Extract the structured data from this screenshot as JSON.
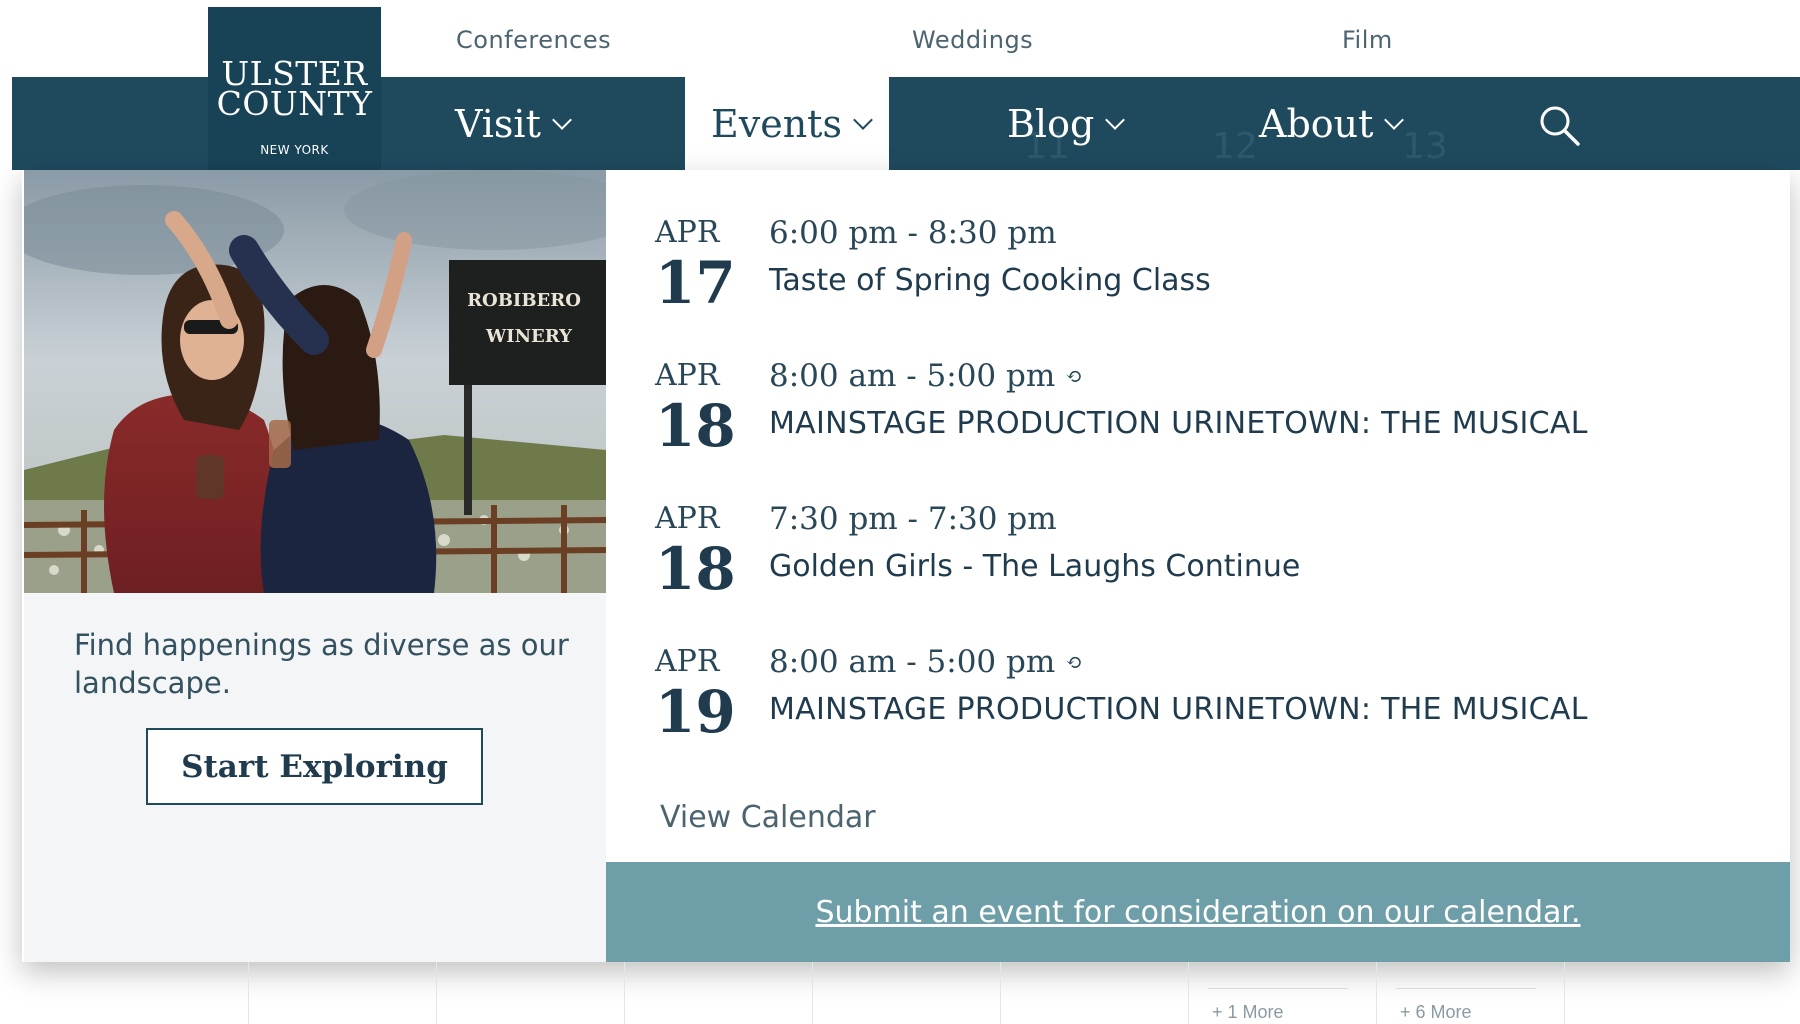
{
  "utility_nav": [
    "Conferences",
    "Weddings",
    "Film"
  ],
  "logo": {
    "line1": "ULSTER",
    "line2": "COUNTY",
    "line3": "NEW YORK"
  },
  "nav": {
    "items": [
      {
        "label": "Visit"
      },
      {
        "label": "Events"
      },
      {
        "label": "Blog"
      },
      {
        "label": "About"
      }
    ],
    "search_icon": "search-icon"
  },
  "background_calendar": {
    "dates": [
      "11",
      "12",
      "13"
    ],
    "more_links": [
      "+ 1 More",
      "+ 6 More"
    ]
  },
  "promo": {
    "image": "photo of two women celebrating outside Robibero Winery sign",
    "sign_text": [
      "ROBIBERO",
      "WINERY"
    ],
    "tagline": "Find happenings as diverse as our landscape.",
    "button_label": "Start Exploring"
  },
  "events": [
    {
      "month": "APR",
      "day": "17",
      "time": "6:00 pm - 8:30 pm",
      "recurring": false,
      "title": "Taste of Spring Cooking Class"
    },
    {
      "month": "APR",
      "day": "18",
      "time": "8:00 am - 5:00 pm",
      "recurring": true,
      "title": "MAINSTAGE PRODUCTION URINETOWN: THE MUSICAL"
    },
    {
      "month": "APR",
      "day": "18",
      "time": "7:30 pm - 7:30 pm",
      "recurring": false,
      "title": "Golden Girls - The Laughs Continue"
    },
    {
      "month": "APR",
      "day": "19",
      "time": "8:00 am - 5:00 pm",
      "recurring": true,
      "title": "MAINSTAGE PRODUCTION URINETOWN: THE MUSICAL"
    }
  ],
  "repeat_symbol": "⟲",
  "view_calendar_label": "View Calendar",
  "submit_label": "Submit an event for consideration on our calendar.",
  "colors": {
    "nav": "#1f4a5e",
    "logo": "#184356",
    "submit_bar": "#6e9ea7",
    "text": "#1f3b4d"
  }
}
